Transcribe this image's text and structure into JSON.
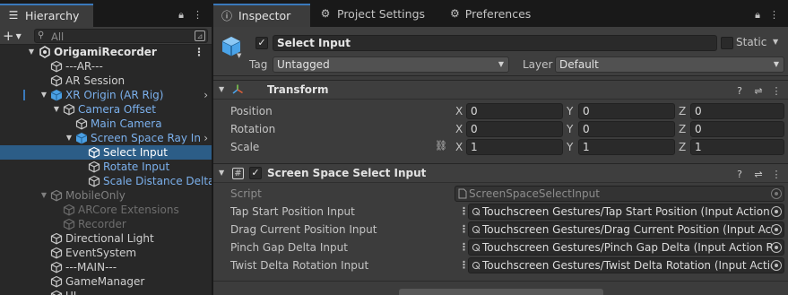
{
  "hierarchy": {
    "tab_label": "Hierarchy",
    "search_placeholder": "All",
    "items": [
      {
        "label": "OrigamiRecorder",
        "depth": 0,
        "kind": "scene"
      },
      {
        "label": "---AR---",
        "depth": 1,
        "kind": "go"
      },
      {
        "label": "AR Session",
        "depth": 1,
        "kind": "go"
      },
      {
        "label": "XR Origin (AR Rig)",
        "depth": 1,
        "kind": "prefab"
      },
      {
        "label": "Camera Offset",
        "depth": 2,
        "kind": "prefab"
      },
      {
        "label": "Main Camera",
        "depth": 3,
        "kind": "prefab"
      },
      {
        "label": "Screen Space Ray In",
        "depth": 3,
        "kind": "prefab"
      },
      {
        "label": "Select Input",
        "depth": 4,
        "kind": "go"
      },
      {
        "label": "Rotate Input",
        "depth": 4,
        "kind": "prefab"
      },
      {
        "label": "Scale Distance Delta",
        "depth": 4,
        "kind": "prefab"
      },
      {
        "label": "MobileOnly",
        "depth": 1,
        "kind": "go"
      },
      {
        "label": "ARCore Extensions",
        "depth": 2,
        "kind": "go"
      },
      {
        "label": "Recorder",
        "depth": 2,
        "kind": "go"
      },
      {
        "label": "Directional Light",
        "depth": 1,
        "kind": "go"
      },
      {
        "label": "EventSystem",
        "depth": 1,
        "kind": "go"
      },
      {
        "label": "---MAIN---",
        "depth": 1,
        "kind": "go"
      },
      {
        "label": "GameManager",
        "depth": 1,
        "kind": "go"
      },
      {
        "label": "UI",
        "depth": 1,
        "kind": "go"
      }
    ]
  },
  "inspector": {
    "tabs": [
      {
        "label": "Inspector",
        "icon": "info-icon"
      },
      {
        "label": "Project Settings",
        "icon": "gear-icon"
      },
      {
        "label": "Preferences",
        "icon": "gear-icon"
      }
    ],
    "gameobject": {
      "active": true,
      "name": "Select Input",
      "static_label": "Static",
      "static": false,
      "tag_label": "Tag",
      "tag_value": "Untagged",
      "layer_label": "Layer",
      "layer_value": "Default"
    },
    "transform": {
      "title": "Transform",
      "rows": [
        {
          "label": "Position",
          "x": "0",
          "y": "0",
          "z": "0"
        },
        {
          "label": "Rotation",
          "x": "0",
          "y": "0",
          "z": "0"
        },
        {
          "label": "Scale",
          "x": "1",
          "y": "1",
          "z": "1"
        }
      ],
      "axis": {
        "x": "X",
        "y": "Y",
        "z": "Z"
      }
    },
    "component": {
      "title": "Screen Space Select Input",
      "enabled": true,
      "script_label": "Script",
      "script_value": "ScreenSpaceSelectInput",
      "properties": [
        {
          "label": "Tap Start Position Input",
          "value": "Touchscreen Gestures/Tap Start Position (Input Action R"
        },
        {
          "label": "Drag Current Position Input",
          "value": "Touchscreen Gestures/Drag Current Position (Input Acti"
        },
        {
          "label": "Pinch Gap Delta Input",
          "value": "Touchscreen Gestures/Pinch Gap Delta (Input Action Re"
        },
        {
          "label": "Twist Delta Rotation Input",
          "value": "Touchscreen Gestures/Twist Delta Rotation (Input Actio"
        }
      ]
    }
  }
}
